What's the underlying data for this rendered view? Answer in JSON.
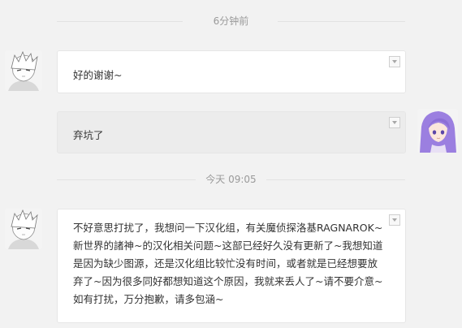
{
  "timestamps": [
    "6分钟前",
    "今天 09:05"
  ],
  "messages": [
    {
      "sender_avatar": "anime-boy-avatar",
      "text": "好的谢谢~"
    },
    {
      "sender_avatar": "purple-hair-girl-avatar",
      "text": "弃坑了"
    },
    {
      "sender_avatar": "anime-boy-avatar",
      "text": "不好意思打扰了，我想问一下汉化组，有关魔侦探洛基RAGNAROK~新世界的諸神~的汉化相关问题~这部已经好久没有更新了~我想知道是因为缺少图源，还是汉化组比较忙没有时间，或者就是已经想要放弃了~因为很多同好都想知道这个原因，我就来丢人了~请不要介意~如有打扰，万分抱歉，请多包涵~"
    }
  ],
  "colors": {
    "background": "#f2f2f2",
    "bubble": "#ffffff",
    "own_bubble": "#ececec",
    "timestamp": "#9a9a9a"
  }
}
